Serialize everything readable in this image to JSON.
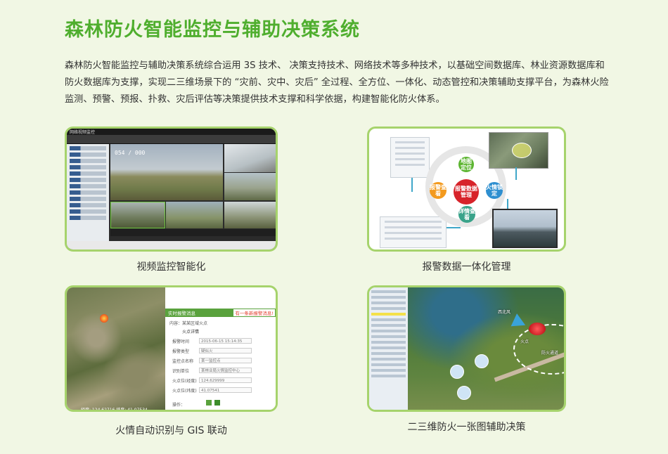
{
  "page": {
    "title": "森林防火智能监控与辅助决策系统",
    "intro": "森林防火智能监控与辅助决策系统综合运用 3S 技术、 决策支持技术、网络技术等多种技术，以基础空间数据库、林业资源数据库和防火数据库为支撑，实现二三维场景下的 “灾前、灾中、灾后” 全过程、全方位、一体化、动态管控和决策辅助支撑平台，为森林火险监测、预警、预报、扑救、灾后评估等决策提供技术支撑和科学依据，构建智能化防火体系。"
  },
  "cards": [
    {
      "caption": "视频监控智能化"
    },
    {
      "caption": "报警数据一体化管理"
    },
    {
      "caption": "火情自动识别与 GIS 联动"
    },
    {
      "caption": "二三维防火一张图辅助决策"
    }
  ],
  "video": {
    "window_title": "网络视频监控",
    "osd": "054 / 000"
  },
  "alarm": {
    "nodes": {
      "top": "地图定位",
      "center": "报警数据管理",
      "right": "火情锁定",
      "bottom": "详情查看",
      "left": "报警查看"
    }
  },
  "fire": {
    "form_title": "实时报警消息",
    "form_tag": "有一条新报警消息!",
    "location": "内容：某某区域火点",
    "section": "火点详情",
    "fields": [
      {
        "label": "报警时间",
        "value": "2015-06-15 15:14:35"
      },
      {
        "label": "报警类型",
        "value": "疑似火"
      },
      {
        "label": "监控点名称",
        "value": "某一监控点"
      },
      {
        "label": "识别单位",
        "value": "某林业局火情监控中心"
      },
      {
        "label": "火点位(经度)",
        "value": "124.629999"
      },
      {
        "label": "火点位(纬度)",
        "value": "41.07541"
      }
    ],
    "actions_label": "操作：",
    "sat_coords": "经度: 124.62716  纬度: 41.07534"
  },
  "map": {
    "labels": {
      "wind": "西北风",
      "fire": "火点",
      "route": "防火通道"
    }
  },
  "colors": {
    "title": "#4fae2e",
    "card_border": "#a6d36c",
    "background": "#f1f7e4",
    "node_top": "#5cb531",
    "node_center": "#d7232a",
    "node_right": "#2e8fd0",
    "node_bottom": "#39a38a",
    "node_left": "#f39a1e"
  }
}
